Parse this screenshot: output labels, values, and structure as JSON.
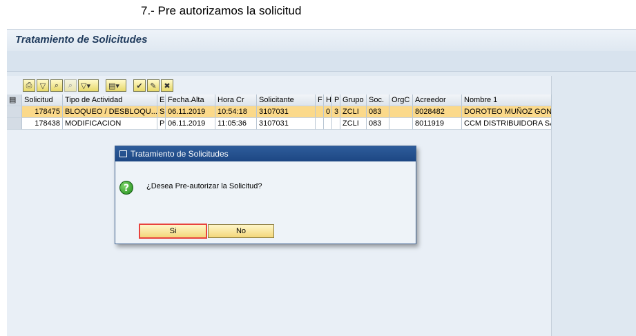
{
  "caption": "7.- Pre autorizamos la solicitud",
  "window": {
    "title": "Tratamiento de Solicitudes"
  },
  "toolbar": {
    "buttons": [
      "print-icon",
      "filter-icon",
      "find-icon",
      "find-next-icon",
      "filter-dropdown-icon",
      "export-icon",
      "approve-icon",
      "edit-icon",
      "reject-icon"
    ]
  },
  "table": {
    "columns": [
      "Solicitud",
      "Tipo de Actividad",
      "E",
      "Fecha.Alta",
      "Hora Cr",
      "Solicitante",
      "F",
      "H",
      "P",
      "Grupo",
      "Soc.",
      "OrgC",
      "Acreedor",
      "Nombre 1"
    ],
    "rows": [
      [
        "178475",
        "BLOQUEO / DESBLOQU...",
        "S",
        "06.11.2019",
        "10:54:18",
        "3107031",
        "",
        "0",
        "3",
        "ZCLI",
        "083",
        "",
        "8028482",
        "DOROTEO MUÑOZ GON"
      ],
      [
        "178438",
        "MODIFICACION",
        "P",
        "06.11.2019",
        "11:05:36",
        "3107031",
        "",
        "",
        "",
        "ZCLI",
        "083",
        "",
        "8011919",
        "CCM DISTRIBUIDORA SA"
      ]
    ]
  },
  "dialog": {
    "title": "Tratamiento de Solicitudes",
    "question": "¿Desea Pre-autorizar la Solicitud?",
    "yes_label": "Si",
    "no_label": "No"
  },
  "colors": {
    "selected_row": "#fbd98a",
    "dialog_header": "#1d4783",
    "button": "#f3d77a"
  }
}
